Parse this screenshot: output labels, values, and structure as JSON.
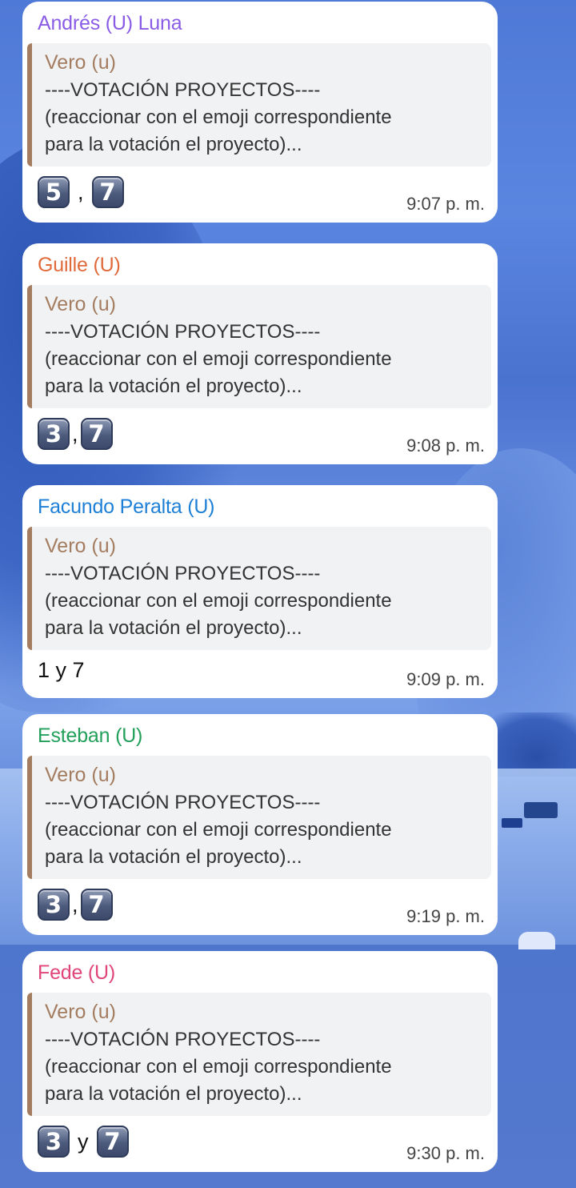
{
  "quote": {
    "name": "Vero (u)",
    "lines": [
      "----VOTACIÓN PROYECTOS----",
      "(reaccionar con el emoji correspondiente",
      "para la votación el proyecto)..."
    ]
  },
  "messages": [
    {
      "sender": "Andrés (U) Luna",
      "sender_color": "#8a5ce6",
      "reply": {
        "first": "5",
        "sep": ",",
        "second": "7"
      },
      "time": "9:07 p. m."
    },
    {
      "sender": "Guille (U)",
      "sender_color": "#e06a3a",
      "reply": {
        "first": "3",
        "sep": ",",
        "second": "7"
      },
      "time": "9:08 p. m."
    },
    {
      "sender": "Facundo Peralta (U)",
      "sender_color": "#1e7fd6",
      "reply": {
        "text": "1 y 7"
      },
      "time": "9:09 p. m."
    },
    {
      "sender": "Esteban (U)",
      "sender_color": "#22a05a",
      "reply": {
        "first": "3",
        "sep": ",",
        "second": "7"
      },
      "time": "9:19 p. m."
    },
    {
      "sender": "Fede (U)",
      "sender_color": "#e0457a",
      "reply": {
        "first": "3",
        "sep": "y",
        "second": "7"
      },
      "time": "9:30 p. m."
    }
  ]
}
